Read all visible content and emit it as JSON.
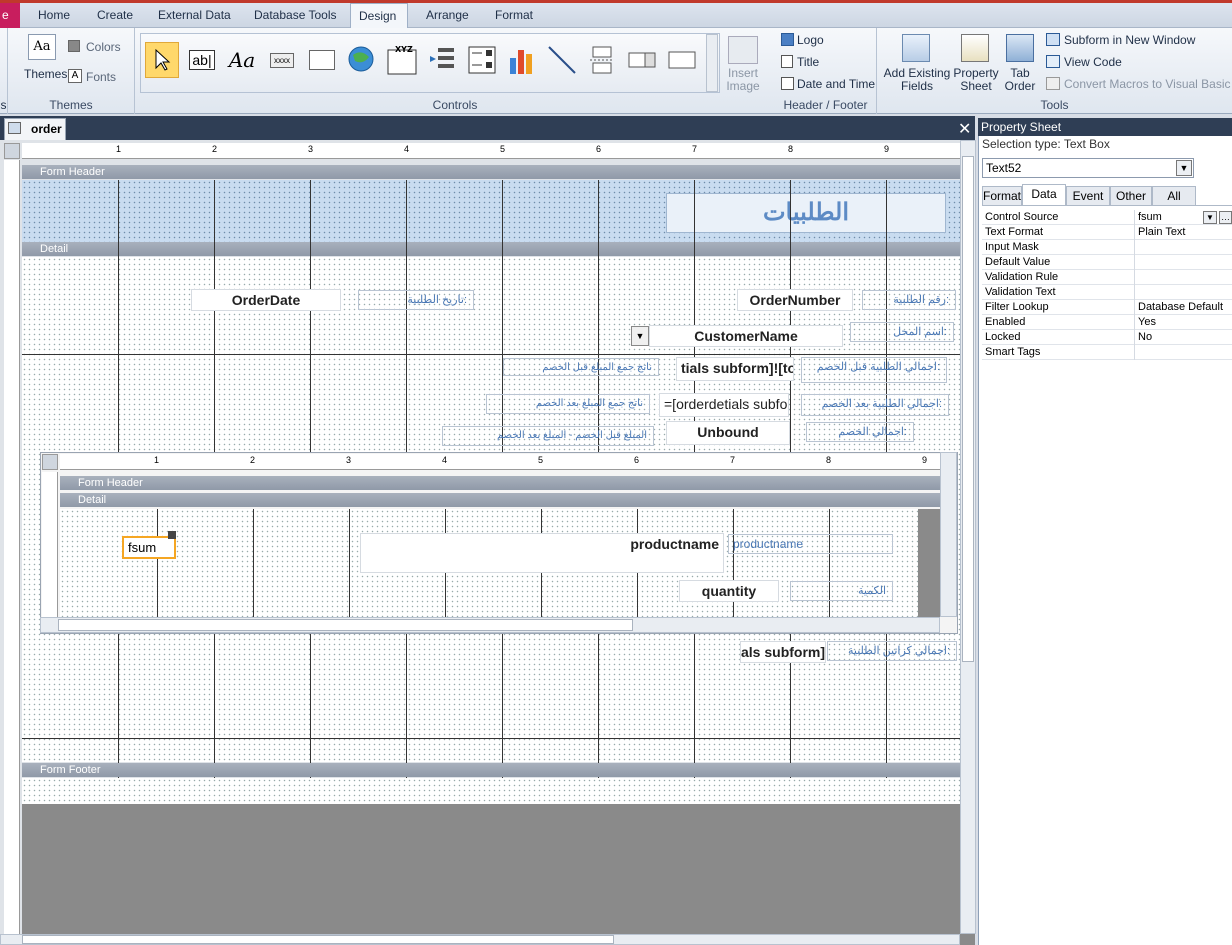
{
  "ribbon": {
    "file_tab": "e",
    "tabs": [
      "Home",
      "Create",
      "External Data",
      "Database Tools",
      "Design",
      "Arrange",
      "Format"
    ],
    "active_tab": "Design",
    "themes": {
      "themes_label": "Themes",
      "colors_label": "Colors",
      "fonts_label": "Fonts",
      "group_label": "Themes",
      "left_stub": "s"
    },
    "controls": {
      "group_label": "Controls",
      "insert_image": "Insert\nImage"
    },
    "header_footer": {
      "logo": "Logo",
      "title": "Title",
      "date_time": "Date and Time",
      "group_label": "Header / Footer"
    },
    "tools": {
      "add_fields": "Add Existing\nFields",
      "property_sheet": "Property\nSheet",
      "tab_order": "Tab\nOrder",
      "subform_window": "Subform in New Window",
      "view_code": "View Code",
      "convert_macros": "Convert Macros to Visual Basic",
      "group_label": "Tools"
    }
  },
  "document": {
    "tab_name": "order"
  },
  "form": {
    "header_band": "Form Header",
    "detail_band": "Detail",
    "footer_band": "Form Footer",
    "title": "الطلبيات",
    "order_date": "OrderDate",
    "order_date_label": "تاريخ الطلبية:",
    "order_number": "OrderNumber",
    "order_number_label": "رقم الطلبية:",
    "customer_name": "CustomerName",
    "customer_name_label": "اسم المحل:",
    "total_before_textbox": "tials subform]![to",
    "total_before_label": "اجمالي الطلبية قبل الخصم:",
    "sum_before_label": "ناتج جمع المبلغ قبل الخصم",
    "total_after_textbox": "=[orderdetials subfo",
    "total_after_label": "اجمالي الطلبية بعد الخصم:",
    "sum_after_label": "ناتج جمع المبلغ بعد الخصم",
    "discount_textbox": "Unbound",
    "discount_label": "اجمالي الخصم:",
    "discount_formula_label": "المبلغ قبل الخصم - المبلغ بعد الخصم",
    "subform_total_textbox": "als subform]![",
    "subform_total_label": "اجمالي كراتين الطلبية:",
    "subform": {
      "header_band": "Form Header",
      "detail_band": "Detail",
      "fsum": "fsum",
      "productname": "productname",
      "productname_label": "productname",
      "quantity": "quantity",
      "quantity_label": "الكمية"
    }
  },
  "ruler": {
    "numbers": [
      "1",
      "2",
      "3",
      "4",
      "5",
      "6",
      "7",
      "8",
      "9"
    ]
  },
  "property_sheet": {
    "title": "Property Sheet",
    "selection_type": "Selection type:  Text Box",
    "selected": "Text52",
    "tabs": [
      "Format",
      "Data",
      "Event",
      "Other",
      "All"
    ],
    "active_tab": "Data",
    "rows": [
      {
        "k": "Control Source",
        "v": "fsum"
      },
      {
        "k": "Text Format",
        "v": "Plain Text"
      },
      {
        "k": "Input Mask",
        "v": ""
      },
      {
        "k": "Default Value",
        "v": ""
      },
      {
        "k": "Validation Rule",
        "v": ""
      },
      {
        "k": "Validation Text",
        "v": ""
      },
      {
        "k": "Filter Lookup",
        "v": "Database Default"
      },
      {
        "k": "Enabled",
        "v": "Yes"
      },
      {
        "k": "Locked",
        "v": "No"
      },
      {
        "k": "Smart Tags",
        "v": ""
      }
    ]
  },
  "colors": {
    "accent": "#c81e5e",
    "title_blue": "#4a78b5",
    "selection": "#f5a623"
  }
}
